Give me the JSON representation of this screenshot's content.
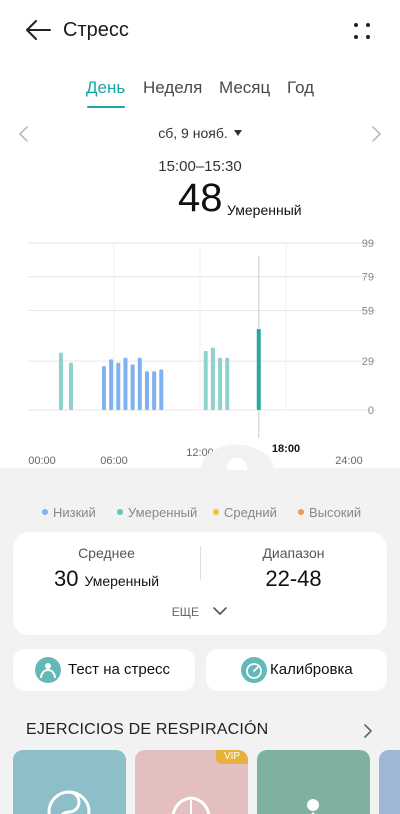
{
  "header": {
    "title": "Стресс"
  },
  "tabs": [
    {
      "label": "День",
      "active": true
    },
    {
      "label": "Неделя",
      "active": false
    },
    {
      "label": "Месяц",
      "active": false
    },
    {
      "label": "Год",
      "active": false
    }
  ],
  "date": {
    "label": "сб, 9 нояб."
  },
  "selection": {
    "time_range": "15:00–15:30",
    "value": "48",
    "level": "Умеренный"
  },
  "chart_data": {
    "type": "bar",
    "x_ticks": [
      "00:00",
      "06:00",
      "12:00",
      "18:00",
      "24:00"
    ],
    "selected_tick": "18:00",
    "y_ticks": [
      "99",
      "79",
      "59",
      "29",
      "0"
    ],
    "y_tick_values": [
      99,
      79,
      59,
      29,
      0
    ],
    "ylim": [
      0,
      99
    ],
    "xlim_hours": [
      0,
      24
    ],
    "bars": [
      {
        "hour": 2.3,
        "value": 34,
        "level": "Умеренный"
      },
      {
        "hour": 3.0,
        "value": 28,
        "level": "Умеренный"
      },
      {
        "hour": 5.3,
        "value": 26,
        "level": "Низкий"
      },
      {
        "hour": 5.8,
        "value": 30,
        "level": "Низкий"
      },
      {
        "hour": 6.3,
        "value": 28,
        "level": "Низкий"
      },
      {
        "hour": 6.8,
        "value": 31,
        "level": "Низкий"
      },
      {
        "hour": 7.3,
        "value": 27,
        "level": "Низкий"
      },
      {
        "hour": 7.8,
        "value": 31,
        "level": "Низкий"
      },
      {
        "hour": 8.3,
        "value": 23,
        "level": "Низкий"
      },
      {
        "hour": 8.8,
        "value": 23,
        "level": "Низкий"
      },
      {
        "hour": 9.3,
        "value": 24,
        "level": "Низкий"
      },
      {
        "hour": 12.4,
        "value": 35,
        "level": "Умеренный"
      },
      {
        "hour": 12.9,
        "value": 37,
        "level": "Умеренный"
      },
      {
        "hour": 13.4,
        "value": 31,
        "level": "Умеренный"
      },
      {
        "hour": 13.9,
        "value": 31,
        "level": "Умеренный"
      },
      {
        "hour": 16.1,
        "value": 48,
        "level": "Умеренный",
        "selected": true
      }
    ]
  },
  "legend": [
    {
      "label": "Низкий",
      "color": "#7fb2f0"
    },
    {
      "label": "Умеренный",
      "color": "#63c3c0"
    },
    {
      "label": "Средний",
      "color": "#f2c232"
    },
    {
      "label": "Высокий",
      "color": "#f2994a"
    }
  ],
  "stats": {
    "average": {
      "label": "Среднее",
      "value": "30",
      "level": "Умеренный"
    },
    "range": {
      "label": "Диапазон",
      "value": "22-48"
    },
    "more_label": "ЕЩЕ"
  },
  "actions": {
    "stress_test": {
      "label": "Тест на стресс"
    },
    "calibration": {
      "label": "Калибровка"
    }
  },
  "exercises": {
    "title": "EJERCICIOS DE RESPIRACIÓN",
    "cards": [
      {
        "color": "#8cbfc7",
        "icon": "yin-yang-icon"
      },
      {
        "color": "#e3bfbf",
        "icon": "brain-icon",
        "badge": "VIP"
      },
      {
        "color": "#7fb1a0",
        "icon": "meditation-icon"
      },
      {
        "color": "#9fb7d6",
        "icon": "card-icon"
      }
    ]
  },
  "colors": {
    "accent": "#1aa6a3",
    "low": "#7fb2f0",
    "moderate": "#63c3c0"
  }
}
